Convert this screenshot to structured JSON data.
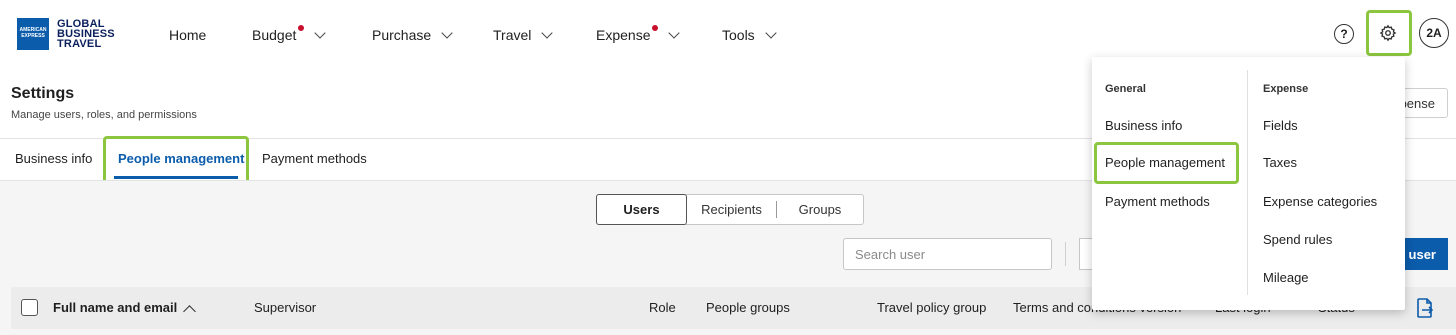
{
  "brand": {
    "logo_label": "AMERICAN EXPRESS",
    "name": "GLOBAL BUSINESS TRAVEL",
    "accent_color": "#0b5cab",
    "highlight_color": "#8cc63f",
    "notification_color": "#c8102e"
  },
  "topnav": {
    "items": [
      {
        "label": "Home"
      },
      {
        "label": "Budget"
      },
      {
        "label": "Purchase"
      },
      {
        "label": "Travel"
      },
      {
        "label": "Expense"
      },
      {
        "label": "Tools"
      }
    ],
    "help_glyph": "?",
    "avatar": "2A"
  },
  "page": {
    "title": "Settings",
    "subtitle": "Manage users, roles, and permissions",
    "partial_button": "pense"
  },
  "tabs": [
    {
      "label": "Business info"
    },
    {
      "label": "People management"
    },
    {
      "label": "Payment methods"
    }
  ],
  "segmented": {
    "items": [
      "Users",
      "Recipients",
      "Groups"
    ],
    "selected": "Users"
  },
  "search": {
    "placeholder": "Search user"
  },
  "add_user": {
    "label": "user"
  },
  "table": {
    "columns": [
      "Full name and email",
      "Supervisor",
      "Role",
      "People groups",
      "Travel policy group",
      "Terms and conditions version",
      "Last login",
      "Status"
    ]
  },
  "settings_menu": {
    "general_heading": "General",
    "general_items": [
      "Business info",
      "People management",
      "Payment methods"
    ],
    "expense_heading": "Expense",
    "expense_items": [
      "Fields",
      "Taxes",
      "Expense categories",
      "Spend rules",
      "Mileage"
    ]
  }
}
